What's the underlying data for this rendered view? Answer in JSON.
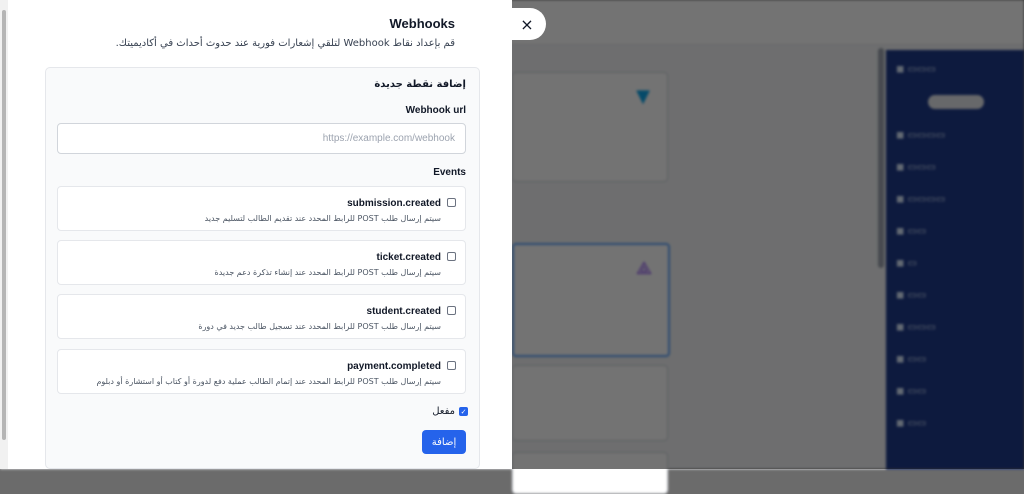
{
  "modal": {
    "title": "Webhooks",
    "subtitle": "قم بإعداد نقاط Webhook لتلقي إشعارات فورية عند حدوث أحداث في أكاديميتك.",
    "close_icon": "×"
  },
  "form": {
    "section_title": "إضافة نقطة جديدة",
    "url_label": "Webhook url",
    "url_placeholder": "https://example.com/webhook",
    "url_value": "",
    "events_label": "Events",
    "events": [
      {
        "name": "submission.created",
        "description": "سيتم إرسال طلب POST للرابط المحدد عند تقديم الطالب لتسليم جديد",
        "checked": false
      },
      {
        "name": "ticket.created",
        "description": "سيتم إرسال طلب POST للرابط المحدد عند إنشاء تذكرة دعم جديدة",
        "checked": false
      },
      {
        "name": "student.created",
        "description": "سيتم إرسال طلب POST للرابط المحدد عند تسجيل طالب جديد في دورة",
        "checked": false
      },
      {
        "name": "payment.completed",
        "description": "سيتم إرسال طلب POST للرابط المحدد عند إتمام الطالب عملية دفع لدورة أو كتاب أو استشارة أو دبلوم",
        "checked": false
      }
    ],
    "enabled_label": "مفعل",
    "enabled_checked": true,
    "add_button_label": "إضافة"
  },
  "colors": {
    "accent": "#2563eb",
    "overlay": "#000000",
    "sidebar": "#1e3a8a"
  }
}
